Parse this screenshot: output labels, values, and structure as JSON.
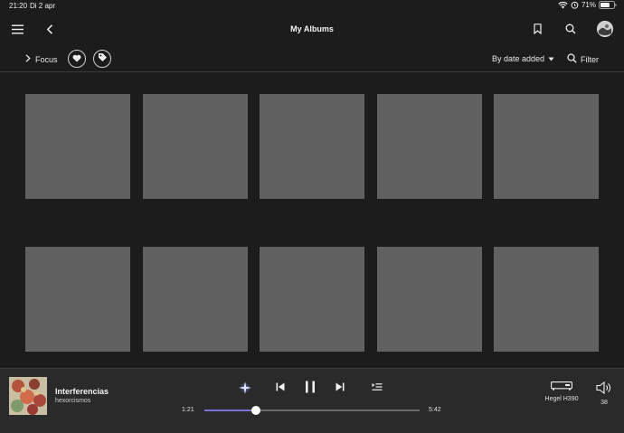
{
  "status_bar": {
    "time": "21:20",
    "date": "Di 2 apr",
    "battery_percent": "71%",
    "battery_level": 0.71,
    "icons": [
      "wifi-icon",
      "alarm-icon",
      "battery-icon"
    ]
  },
  "header": {
    "title": "My Albums",
    "icons": [
      "menu-icon",
      "back-chevron-icon",
      "bookmark-icon",
      "search-icon",
      "avatar"
    ]
  },
  "filter_bar": {
    "focus_label": "Focus",
    "sort_label": "By date added",
    "filter_label": "Filter",
    "icons": [
      "chevron-right-icon",
      "heart-icon",
      "tag-icon",
      "caret-down-icon",
      "search-icon"
    ]
  },
  "albums": {
    "visible_count": 10,
    "placeholder_color": "#616161"
  },
  "now_playing": {
    "title": "Interferencias",
    "artist": "hexorcismos",
    "elapsed": "1:21",
    "duration": "5:42",
    "progress": 0.24,
    "device_name": "Hegel H390",
    "volume": "38",
    "accent_color": "#7b73d9",
    "icons": [
      "sparkle-icon",
      "previous-icon",
      "pause-icon",
      "next-icon",
      "queue-icon",
      "device-icon",
      "speaker-icon"
    ]
  }
}
